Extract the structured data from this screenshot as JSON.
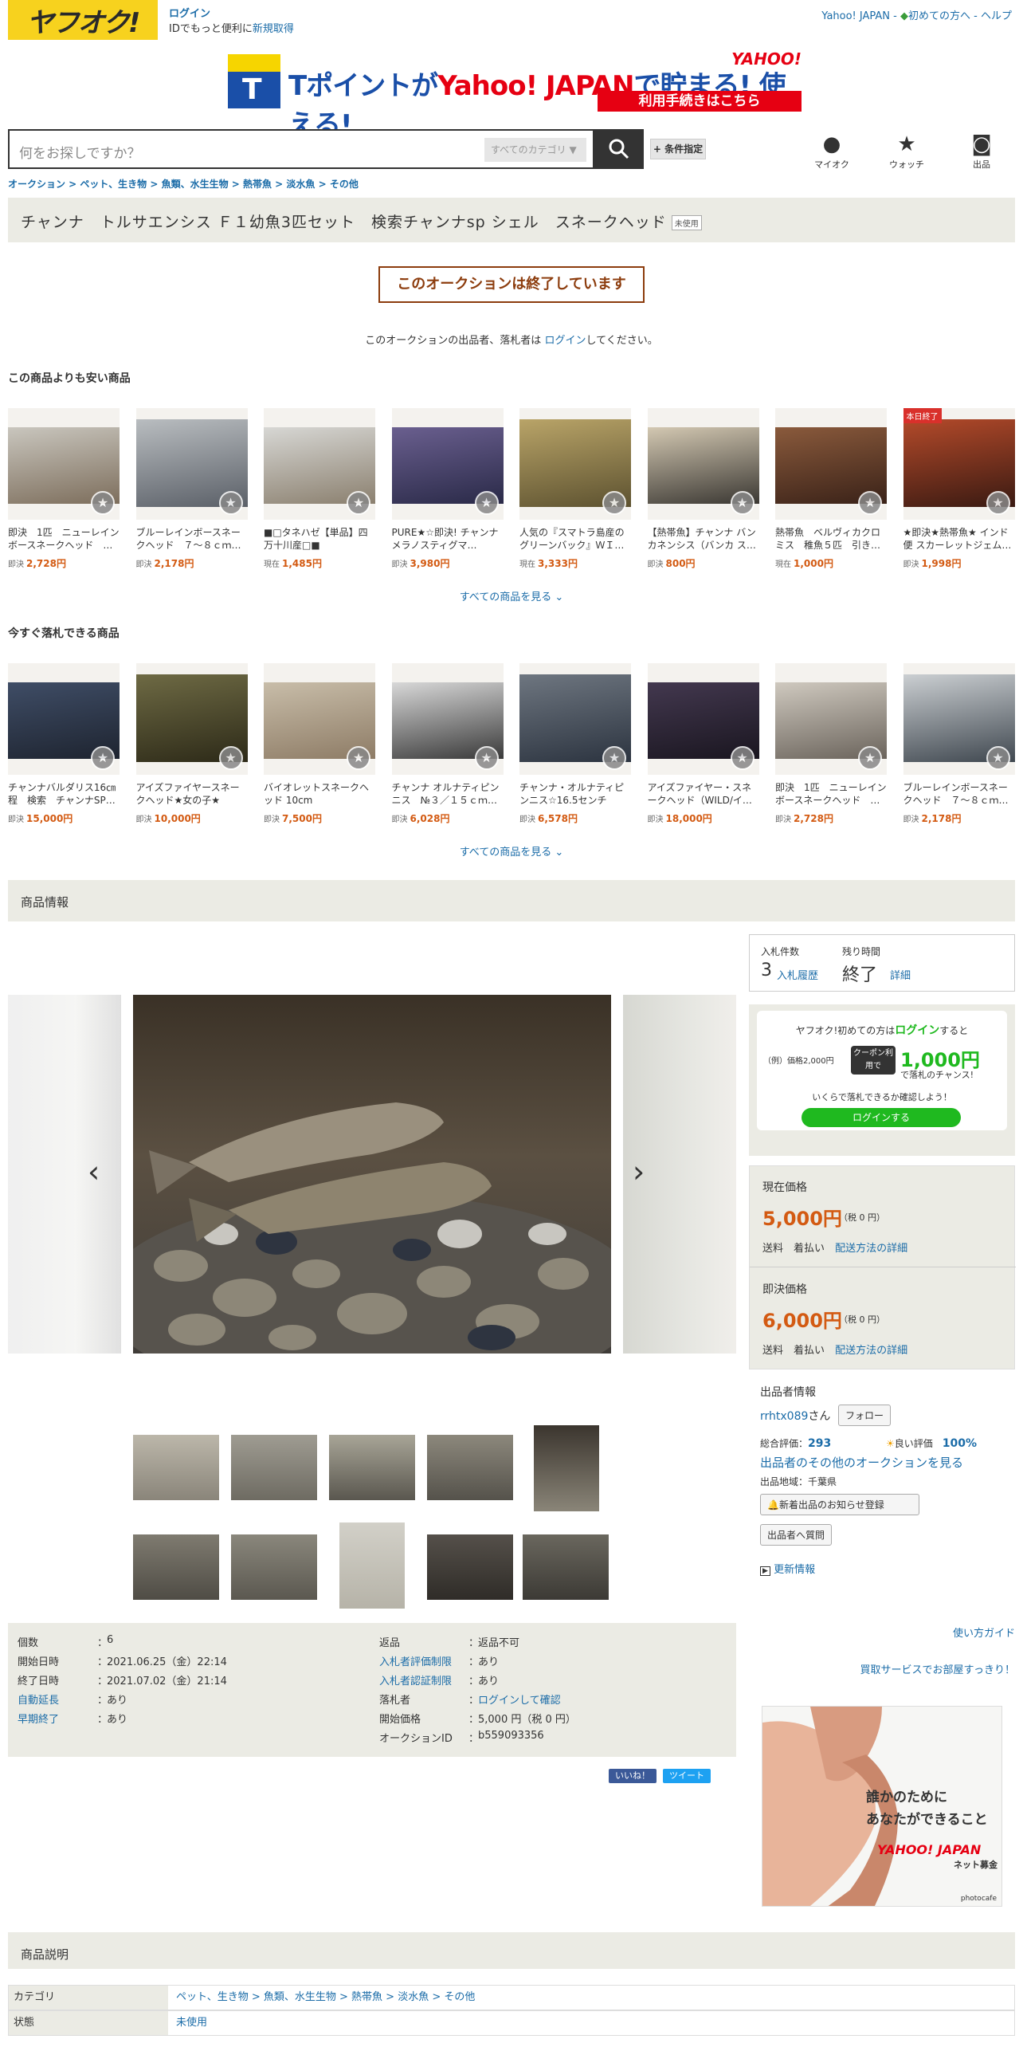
{
  "header": {
    "logo_text": "ヤフオク!",
    "login_label": "ログイン",
    "login_sub_prefix": "IDでもっと便利に",
    "signup_link": "新規取得",
    "top_links": [
      "Yahoo! JAPAN",
      "初めての方へ",
      "ヘルプ"
    ]
  },
  "banner": {
    "text_tpoint": "Tポイントが",
    "text_yahoo": "Yahoo! JAPAN",
    "text_rest": "で貯まる! 使える!",
    "yj_logo": "YAHOO!",
    "cta": "利用手続きはこちら"
  },
  "search": {
    "placeholder": "何をお探しですか？",
    "category": "すべてのカテゴリ",
    "conditions_label": "+ 条件指定"
  },
  "nav_icons": [
    {
      "label": "マイオク",
      "icon": "person-icon"
    },
    {
      "label": "ウォッチ",
      "icon": "star-icon"
    },
    {
      "label": "出品",
      "icon": "camera-icon"
    }
  ],
  "breadcrumb": "オークション > ペット、生き物 > 魚類、水生生物 > 熱帯魚 > 淡水魚 > その他",
  "title": "チャンナ　トルサエンシス Ｆ１幼魚3匹セット　検索チャンナsp シェル　スネークヘッド",
  "condition_badge": "未使用",
  "ended_notice": "このオークションは終了しています",
  "ended_note_prefix": "このオークションの出品者、落札者は",
  "ended_note_link": "ログイン",
  "ended_note_suffix": "してください。",
  "cheaper": {
    "heading": "この商品よりも安い商品",
    "see_all": "すべての商品を見る",
    "items": [
      {
        "name": "即決　1匹　ニューレインボースネークヘッド　…",
        "price_label": "即決",
        "price": "2,728円",
        "tag": ""
      },
      {
        "name": "ブルーレインボースネークヘッド　７～８ｃｍ…",
        "price_label": "即決",
        "price": "2,178円",
        "tag": ""
      },
      {
        "name": "■□タネハゼ【単品】四万十川産□■",
        "price_label": "現在",
        "price": "1,485円",
        "tag": ""
      },
      {
        "name": "PURE★☆即決! チャンナ　メラノスティグマ…",
        "price_label": "即決",
        "price": "3,980円",
        "tag": ""
      },
      {
        "name": "人気の『スマトラ島産のグリーンバック』ＷＩ…",
        "price_label": "現在",
        "price": "3,333円",
        "tag": ""
      },
      {
        "name": "【熱帯魚】チャンナ バンカネンシス（バンカ ス…",
        "price_label": "即決",
        "price": "800円",
        "tag": ""
      },
      {
        "name": "熱帯魚　ベルヴィカクロミス　稚魚５匹　引き…",
        "price_label": "現在",
        "price": "1,000円",
        "tag": ""
      },
      {
        "name": "★即決★熱帯魚★ インド便 スカーレットジェム…",
        "price_label": "即決",
        "price": "1,998円",
        "tag": "本日終了"
      }
    ]
  },
  "buynow": {
    "heading": "今すぐ落札できる商品",
    "see_all": "すべての商品を見る",
    "items": [
      {
        "name": "チャンナバルダリス16㎝程　検索　チャンナSP…",
        "price_label": "即決",
        "price": "15,000円"
      },
      {
        "name": "アイズファイヤースネークヘッド★女の子★",
        "price_label": "即決",
        "price": "10,000円"
      },
      {
        "name": "バイオレットスネークヘッド 10cm",
        "price_label": "即決",
        "price": "7,500円"
      },
      {
        "name": "チャンナ オルナティピンニス　№３／１５ｃｍ…",
        "price_label": "即決",
        "price": "6,028円"
      },
      {
        "name": "チャンナ・オルナティピンニス☆16.5センチ±☆…",
        "price_label": "即決",
        "price": "6,578円"
      },
      {
        "name": "アイズファイヤー・スネークヘッド（WILD/イ…",
        "price_label": "即決",
        "price": "18,000円"
      },
      {
        "name": "即決　1匹　ニューレインボースネークヘッド　…",
        "price_label": "即決",
        "price": "2,728円"
      },
      {
        "name": "ブルーレインボースネークヘッド　７～８ｃｍ…",
        "price_label": "即決",
        "price": "2,178円"
      }
    ]
  },
  "item_info_heading": "商品情報",
  "specs_left": [
    {
      "k": "個数",
      "v": "6",
      "link": false
    },
    {
      "k": "開始日時",
      "v": "2021.06.25（金）22:14",
      "link": false
    },
    {
      "k": "終了日時",
      "v": "2021.07.02（金）21:14",
      "link": false
    },
    {
      "k": "自動延長",
      "v": "あり",
      "link": true
    },
    {
      "k": "早期終了",
      "v": "あり",
      "link": true
    }
  ],
  "specs_right": [
    {
      "k": "返品",
      "v": "返品不可",
      "link": false,
      "vlink": false
    },
    {
      "k": "入札者評価制限",
      "v": "あり",
      "link": true,
      "vlink": false
    },
    {
      "k": "入札者認証制限",
      "v": "あり",
      "link": true,
      "vlink": false
    },
    {
      "k": "落札者",
      "v": "ログインして確認",
      "link": false,
      "vlink": true
    },
    {
      "k": "開始価格",
      "v": "5,000 円（税 0 円）",
      "link": false,
      "vlink": false
    },
    {
      "k": "オークションID",
      "v": "b559093356",
      "link": false,
      "vlink": false
    }
  ],
  "social": {
    "like": "いいね！",
    "tweet": "ツイート"
  },
  "side": {
    "bid_count_label": "入札件数",
    "bid_count": "3",
    "bid_history": "入札履歴",
    "time_left_label": "残り時間",
    "time_left": "終了",
    "detail": "詳細",
    "promo_line1a": "ヤフオク!初めての方は",
    "promo_line1b": "ログイン",
    "promo_line1c": "すると",
    "promo_example": "（例）価格2,000円",
    "promo_coupon": "クーポン利用で",
    "promo_amount": "1,000円",
    "promo_chance": "で落札のチャンス!",
    "promo_check": "いくらで落札できるか確認しよう！",
    "promo_button": "ログインする",
    "current_label": "現在価格",
    "current_price": "5,000円",
    "current_tax": "（税 0 円）",
    "shipping_label": "送料",
    "shipping_value": "着払い",
    "shipping_link": "配送方法の詳細",
    "buynow_label": "即決価格",
    "buynow_price": "6,000円",
    "buynow_tax": "（税 0 円）",
    "seller_heading": "出品者情報",
    "seller_name": "rrhtx089",
    "seller_suffix": "さん",
    "follow": "フォロー",
    "rating_label": "総合評価：",
    "rating": "293",
    "good_label": "良い評価",
    "good_pct": "100%",
    "other_auctions": "出品者のその他のオークションを見る",
    "region": "出品地域：千葉県",
    "notify_btn": "新着出品のお知らせ登録",
    "ask_btn": "出品者へ質問",
    "update_info": "更新情報",
    "guide": "使い方ガイド",
    "buy_service": "買取サービスでお部屋すっきり！",
    "ad_line1": "誰かのために",
    "ad_line2": "あなたができること",
    "ad_logo": "YAHOO! JAPAN",
    "ad_brand": "ネット募金",
    "ad_credit": "photocafe"
  },
  "desc_heading": "商品説明",
  "cat_table": [
    {
      "k": "カテゴリ",
      "v": "ペット、生き物 > 魚類、水生生物 > 熱帯魚 > 淡水魚 > その他"
    },
    {
      "k": "状態",
      "v": "未使用"
    }
  ],
  "colors": {
    "accent": "#d35a12",
    "link": "#1b6ca8",
    "panel": "#ebebe4",
    "ended": "#8c3c0d"
  }
}
